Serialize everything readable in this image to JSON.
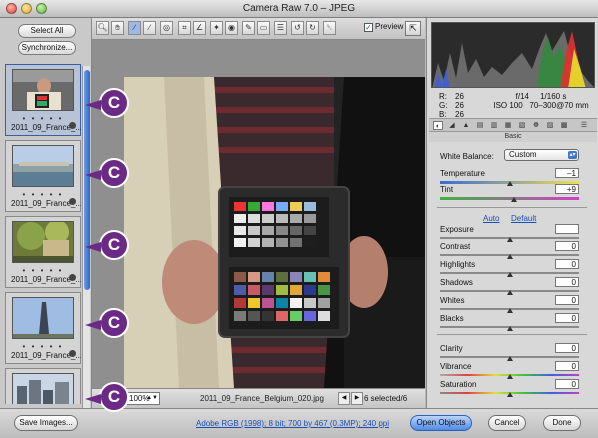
{
  "window": {
    "title": "Camera Raw 7.0  –  JPEG"
  },
  "filmstrip": {
    "select_all": "Select All",
    "synchronize": "Synchronize...",
    "thumbnails": [
      {
        "name": "2011_09_France_...",
        "stars": "• • • • •",
        "selected": true
      },
      {
        "name": "2011_09_France_...",
        "stars": "• • • • •",
        "selected": false
      },
      {
        "name": "2011_09_France_...",
        "stars": "• • • • •",
        "selected": false
      },
      {
        "name": "2011_09_France_...",
        "stars": "• • • • •",
        "selected": false
      },
      {
        "name": "",
        "stars": "",
        "selected": false
      }
    ],
    "callout_letter": "C"
  },
  "toolbar": {
    "tools": [
      "zoom-icon",
      "hand-icon",
      "white-balance-icon",
      "color-sampler-icon",
      "targeted-adjust-icon",
      "crop-icon",
      "straighten-icon",
      "spot-removal-icon",
      "red-eye-icon",
      "adjustment-brush-icon",
      "graduated-filter-icon",
      "preferences-icon",
      "rotate-left-icon",
      "rotate-right-icon",
      "trash-icon"
    ],
    "preview_label": "Preview",
    "preview_checked": true
  },
  "status": {
    "zoom": "100%",
    "filename": "2011_09_France_Belgium_020.jpg",
    "selected": "6 selected/6"
  },
  "readout": {
    "r_label": "R:",
    "r_value": "26",
    "g_label": "G:",
    "g_value": "26",
    "b_label": "B:",
    "b_value": "26",
    "aperture": "f/14",
    "shutter": "1/160 s",
    "iso": "ISO 100",
    "lens": "70–300@70 mm"
  },
  "basic": {
    "panel_title": "Basic",
    "white_balance_label": "White Balance:",
    "white_balance_value": "Custom",
    "auto": "Auto",
    "default": "Default",
    "sliders": [
      {
        "key": "temperature",
        "label": "Temperature",
        "value": "–1",
        "pos": 0.5
      },
      {
        "key": "tint",
        "label": "Tint",
        "value": "+9",
        "pos": 0.53
      },
      {
        "key": "exposure",
        "label": "Exposure",
        "value": "",
        "pos": 0.5
      },
      {
        "key": "contrast",
        "label": "Contrast",
        "value": "0",
        "pos": 0.5
      },
      {
        "key": "highlights",
        "label": "Highlights",
        "value": "0",
        "pos": 0.5
      },
      {
        "key": "shadows",
        "label": "Shadows",
        "value": "0",
        "pos": 0.5
      },
      {
        "key": "whites",
        "label": "Whites",
        "value": "0",
        "pos": 0.5
      },
      {
        "key": "blacks",
        "label": "Blacks",
        "value": "0",
        "pos": 0.5
      },
      {
        "key": "clarity",
        "label": "Clarity",
        "value": "0",
        "pos": 0.5
      },
      {
        "key": "vibrance",
        "label": "Vibrance",
        "value": "0",
        "pos": 0.5
      },
      {
        "key": "saturation",
        "label": "Saturation",
        "value": "0",
        "pos": 0.5
      }
    ]
  },
  "bottom": {
    "save_images": "Save Images...",
    "workflow_info": "Adobe RGB (1998); 8 bit; 700 by 467 (0.3MP); 240 ppi",
    "open_objects": "Open Objects",
    "cancel": "Cancel",
    "done": "Done"
  },
  "colors": {
    "callout": "#6b2a86",
    "accent_blue": "#3f74cf",
    "link": "#1a4fb8"
  }
}
